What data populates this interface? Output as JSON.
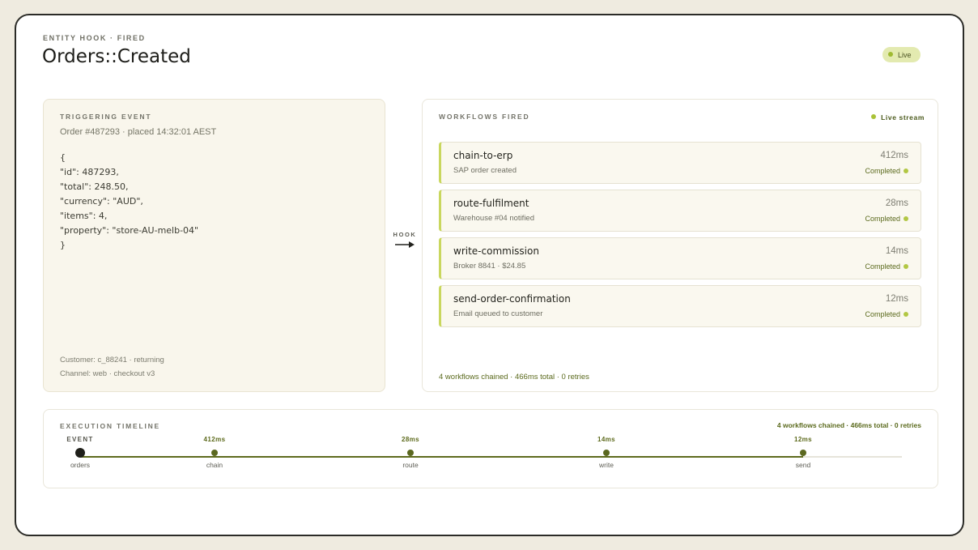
{
  "header": {
    "eyebrow": "ENTITY HOOK · FIRED",
    "title": "Orders::Created",
    "live_label": "Live"
  },
  "trigger": {
    "label": "TRIGGERING EVENT",
    "meta": "Order #487293 · placed 14:32:01 AEST",
    "json_lines": [
      "{",
      "\"id\": 487293,",
      "\"total\": 248.50,",
      "\"currency\": \"AUD\",",
      "\"items\": 4,",
      "\"property\": \"store-AU-melb-04\"",
      "}"
    ],
    "customer": "Customer: c_88241 · returning",
    "channel": "Channel: web · checkout v3"
  },
  "hook": {
    "label": "HOOK"
  },
  "workflows": {
    "label": "WORKFLOWS FIRED",
    "stream_label": "Live stream",
    "items": [
      {
        "name": "chain-to-erp",
        "duration": "412ms",
        "desc": "SAP order created",
        "status": "Completed"
      },
      {
        "name": "route-fulfilment",
        "duration": "28ms",
        "desc": "Warehouse #04 notified",
        "status": "Completed"
      },
      {
        "name": "write-commission",
        "duration": "14ms",
        "desc": "Broker 8841 · $24.85",
        "status": "Completed"
      },
      {
        "name": "send-order-confirmation",
        "duration": "12ms",
        "desc": "Email queued to customer",
        "status": "Completed"
      }
    ],
    "summary": "4 workflows chained · 466ms total · 0 retries"
  },
  "timeline": {
    "label": "EXECUTION TIMELINE",
    "summary": "4 workflows chained · 466ms total · 0 retries",
    "nodes": [
      {
        "top": "EVENT",
        "bottom": "orders"
      },
      {
        "top": "412ms",
        "bottom": "chain"
      },
      {
        "top": "28ms",
        "bottom": "route"
      },
      {
        "top": "14ms",
        "bottom": "write"
      },
      {
        "top": "12ms",
        "bottom": "send"
      }
    ]
  },
  "colors": {
    "accent": "#c9d75e",
    "status_green": "#5b6a1d",
    "live_dot": "#9fba30"
  }
}
